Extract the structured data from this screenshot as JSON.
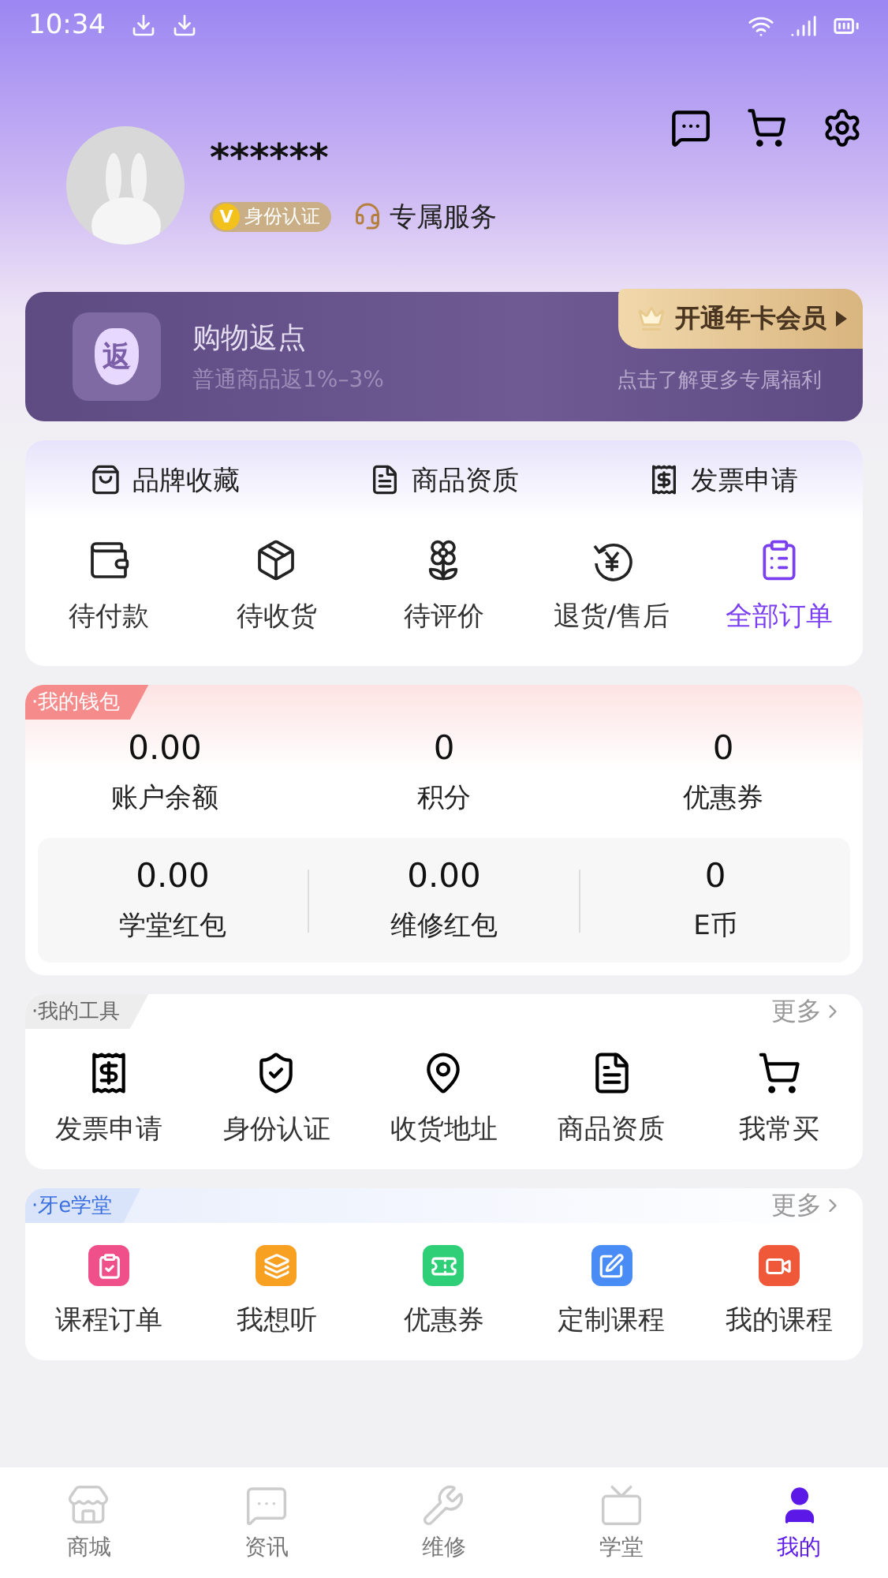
{
  "status_bar": {
    "time": "10:34"
  },
  "profile": {
    "name": "******",
    "verify_badge": {
      "icon": "V",
      "label": "身份认证"
    },
    "service": "专属服务"
  },
  "banner": {
    "icon_text": "返",
    "title": "购物返点",
    "subtitle": "普通商品返1%–3%",
    "vip_button": "开通年卡会员",
    "note": "点击了解更多专属福利"
  },
  "quick_links": [
    {
      "label": "品牌收藏"
    },
    {
      "label": "商品资质"
    },
    {
      "label": "发票申请"
    }
  ],
  "orders": [
    {
      "label": "待付款",
      "selected": false
    },
    {
      "label": "待收货",
      "selected": false
    },
    {
      "label": "待评价",
      "selected": false
    },
    {
      "label": "退货/售后",
      "selected": false
    },
    {
      "label": "全部订单",
      "selected": true
    }
  ],
  "wallet": {
    "title": "·我的钱包",
    "top": [
      {
        "value": "0.00",
        "label": "账户余额"
      },
      {
        "value": "0",
        "label": "积分"
      },
      {
        "value": "0",
        "label": "优惠券"
      }
    ],
    "bottom": [
      {
        "value": "0.00",
        "label": "学堂红包"
      },
      {
        "value": "0.00",
        "label": "维修红包"
      },
      {
        "value": "0",
        "label": "E币"
      }
    ]
  },
  "tools": {
    "title": "·我的工具",
    "more": "更多",
    "items": [
      {
        "label": "发票申请"
      },
      {
        "label": "身份认证"
      },
      {
        "label": "收货地址"
      },
      {
        "label": "商品资质"
      },
      {
        "label": "我常买"
      }
    ]
  },
  "school": {
    "title": "·牙e学堂",
    "more": "更多",
    "items": [
      {
        "label": "课程订单",
        "color": "#f0508a"
      },
      {
        "label": "我想听",
        "color": "#f7a021"
      },
      {
        "label": "优惠券",
        "color": "#2fcf78"
      },
      {
        "label": "定制课程",
        "color": "#4a8cf5"
      },
      {
        "label": "我的课程",
        "color": "#f0583a"
      }
    ]
  },
  "tabs": [
    {
      "label": "商城",
      "selected": false
    },
    {
      "label": "资讯",
      "selected": false
    },
    {
      "label": "维修",
      "selected": false
    },
    {
      "label": "学堂",
      "selected": false
    },
    {
      "label": "我的",
      "selected": true
    }
  ]
}
